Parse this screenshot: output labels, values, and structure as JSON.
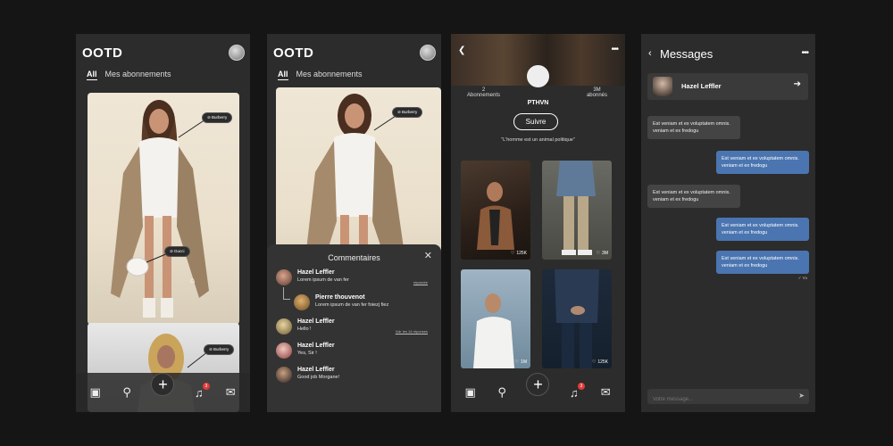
{
  "feed": {
    "title": "OOTD",
    "tabs": [
      "All",
      "Mes abonnements"
    ],
    "tags": [
      "Burberry",
      "Gucci",
      "Burberry"
    ]
  },
  "comments": {
    "title": "Commentaires",
    "items": [
      {
        "name": "Hazel Leffler",
        "text": "Lorem ipsum de van fer",
        "meta": "répondre"
      },
      {
        "name": "Pierre thouvenot",
        "text": "Lorem ipsum de van fer foiezj fiez",
        "meta": ""
      },
      {
        "name": "Hazel Leffler",
        "text": "Hello !",
        "meta": "Voir les 14 réponses"
      },
      {
        "name": "Hazel Leffler",
        "text": "Yes, Sir !",
        "meta": ""
      },
      {
        "name": "Hazel Leffler",
        "text": "Good job Morgane!",
        "meta": ""
      }
    ]
  },
  "profile": {
    "stats": [
      {
        "value": "2",
        "label": "Abonnements"
      },
      {
        "value": "3M",
        "label": "abonnés"
      }
    ],
    "name": "PTHVN",
    "follow_label": "Suivre",
    "bio": "\"L'homme est un animal politique\"",
    "posts": [
      {
        "likes": "125K"
      },
      {
        "likes": "3M"
      },
      {
        "likes": "1M"
      },
      {
        "likes": "125K"
      }
    ]
  },
  "nav": {
    "notif_count": "3"
  },
  "messages": {
    "title": "Messages",
    "contact": "Hazel Leffler",
    "bubbles": [
      {
        "dir": "in",
        "text": "Est veniam et ex voluptatem omnis. veniam et ex fredogu"
      },
      {
        "dir": "out",
        "text": "Est veniam et ex voluptatem omnis. veniam et ex fredogu"
      },
      {
        "dir": "in",
        "text": "Est veniam et ex voluptatem omnis. veniam et ex fredogu"
      },
      {
        "dir": "out",
        "text": "Est veniam et ex voluptatem omnis. veniam et ex fredogu"
      },
      {
        "dir": "out",
        "text": "Est veniam et ex voluptatem omnis. veniam et ex fredogu"
      }
    ],
    "seen_label": "✓ Vu",
    "input_placeholder": "Votre message..."
  }
}
